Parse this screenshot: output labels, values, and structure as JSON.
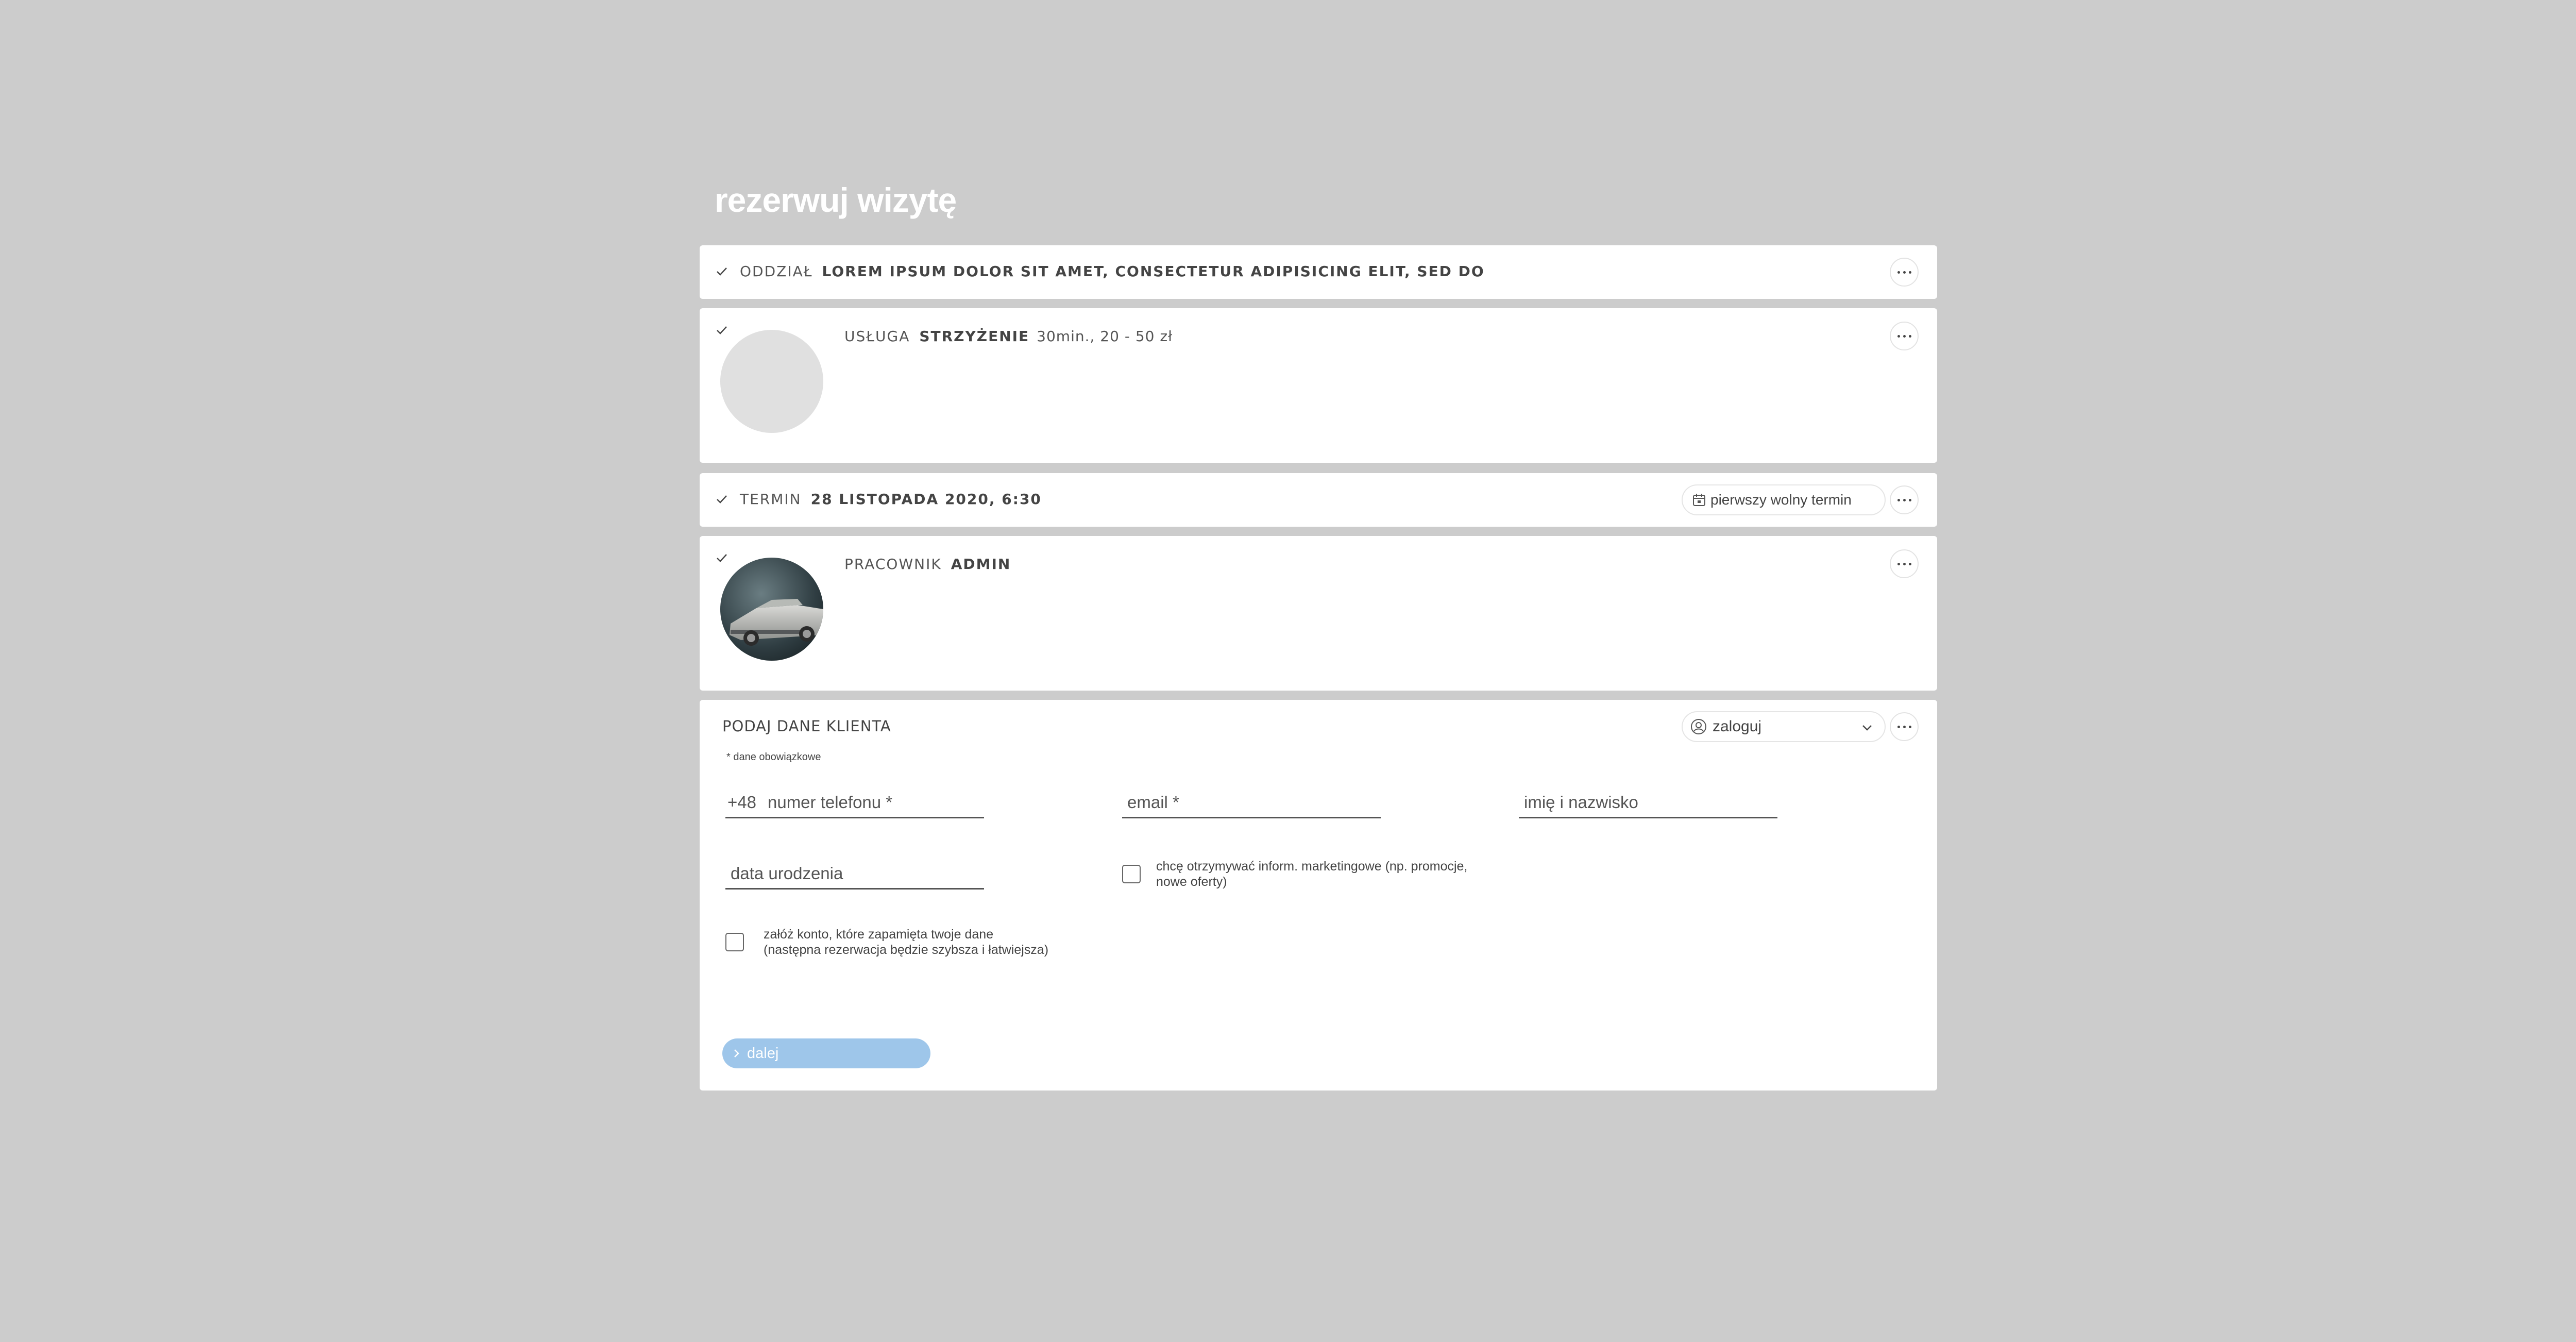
{
  "page_title": "rezerwuj wizytę",
  "branch": {
    "label": "ODDZIAŁ",
    "value": "LOREM IPSUM DOLOR SIT AMET, CONSECTETUR ADIPISICING ELIT, SED DO"
  },
  "service": {
    "label": "USŁUGA",
    "value": "STRZYŻENIE",
    "details": "30min., 20 - 50 zł"
  },
  "date": {
    "label": "TERMIN",
    "value": "28 LISTOPADA 2020, 6:30",
    "first_free_button": "pierwszy wolny termin"
  },
  "employee": {
    "label": "PRACOWNIK",
    "value": "ADMIN"
  },
  "client": {
    "title": "PODAJ DANE KLIENTA",
    "required_note": "* dane obowiązkowe",
    "login_select": "zaloguj",
    "phone_prefix": "+48",
    "phone_placeholder": "numer telefonu *",
    "email_placeholder": "email *",
    "name_placeholder": "imię i nazwisko",
    "birthdate_placeholder": "data urodzenia",
    "marketing_line1": "chcę otrzymywać inform. marketingowe (np. promocje,",
    "marketing_line2": "nowe oferty)",
    "account_line1": "załóż konto, które zapamięta twoje dane",
    "account_line2": "(następna rezerwacja będzie szybsza i łatwiejsza)",
    "next_button": "dalej"
  },
  "icons": {
    "check": "check-icon",
    "more": "more-icon",
    "calendar": "calendar-icon",
    "user": "user-circle-icon",
    "chevron_down": "chevron-down-icon",
    "chevron_right": "chevron-right-icon"
  },
  "colors": {
    "background": "#cccccc",
    "card": "#ffffff",
    "next_button": "#9ec6ea"
  }
}
